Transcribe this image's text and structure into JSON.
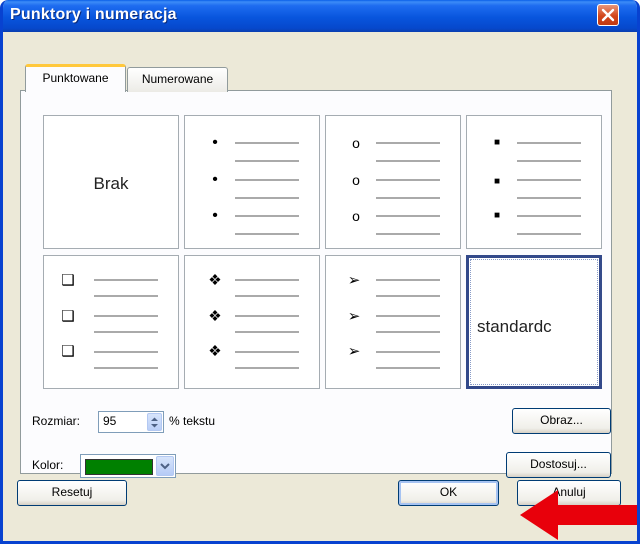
{
  "dialog": {
    "title": "Punktory i numeracja",
    "tabs": [
      {
        "label": "Punktowane",
        "active": true
      },
      {
        "label": "Numerowane",
        "active": false
      }
    ]
  },
  "bullet_styles": [
    {
      "kind": "none",
      "label": "Brak"
    },
    {
      "kind": "dot",
      "glyph": "•"
    },
    {
      "kind": "circle",
      "glyph": "o"
    },
    {
      "kind": "square",
      "glyph": "■"
    },
    {
      "kind": "hollow-square",
      "glyph": "❑"
    },
    {
      "kind": "diamond",
      "glyph": "❖"
    },
    {
      "kind": "arrowhead",
      "glyph": "➢"
    },
    {
      "kind": "custom",
      "label": "standardc",
      "selected": true
    }
  ],
  "size": {
    "label": "Rozmiar:",
    "value": "95",
    "unit": "% tekstu"
  },
  "color": {
    "label": "Kolor:",
    "value": "#008000"
  },
  "buttons": {
    "picture": "Obraz...",
    "customize": "Dostosuj...",
    "reset": "Resetuj",
    "ok": "OK",
    "cancel": "Anuluj"
  },
  "colors": {
    "title_bar": "#0A5FE8",
    "face": "#ECE9D8",
    "annotation_arrow": "#E8000B"
  }
}
